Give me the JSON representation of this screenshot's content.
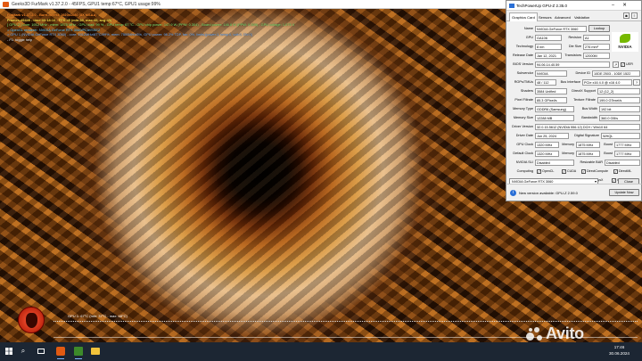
{
  "furmark": {
    "window_title": "Geeks3D FurMark v1.37.2.0 - 45FPS, GPU1 temp:67°C, GPU1 usage:99%",
    "osd": {
      "title": "FurMark v1.37.2.0 - Burn-in test, 1920x1080 (8X MSAA)",
      "frames": "Frames:49445 - time:00:18:13 - FPS:45 (min:39, max:49, avg:45)",
      "gpu2": "[ GPU-Z ] core: 1912 MHz - mem: 1875 MHz - GPU load: 99 % - GPU temp: 67 °C - GPU chip power: 147.9 W (PPW: 0.304) - Board power: 146.8 W (PPW: 0.309) - GPU voltage: 1.075 V",
      "opengl": "> OpenGL renderer: NVIDIA GeForce RTX 3060/PCIe/SSE2",
      "gpu1": "> GPU 1 (NVIDIA GeForce RTX 3060) - core: 1912MHz/67°C/99%, mem: 7500MHz/6%, GPU power: 98.2% TDP, fan: 0%, limits:[power:1, temp:0, volt:0, OV:0]",
      "help": "- F1: toggle help"
    },
    "graph_label": "GPU 1: 67°C (min: 37°C - max: 68°C)"
  },
  "gpuz": {
    "title": "TechPowerUp GPU-Z 2.35.0",
    "tabs": [
      "Graphics Card",
      "Sensors",
      "Advanced",
      "Validation"
    ],
    "lookup_label": "Lookup",
    "vendor_logo_text": "NVIDIA",
    "rows": {
      "name": {
        "label": "Name",
        "value": "NVIDIA GeForce RTX 3060"
      },
      "gpu": {
        "label": "GPU",
        "value": "GA106",
        "label2": "Revision",
        "value2": "A1"
      },
      "tech": {
        "label": "Technology",
        "value": "8 nm",
        "label2": "Die Size",
        "value2": "276 mm²"
      },
      "release": {
        "label": "Release Date",
        "value": "Jan 12, 2021",
        "label2": "Transistors",
        "value2": "12000M"
      },
      "bios": {
        "label": "BIOS Version",
        "value": "94.06.14.40.59",
        "uefi": "UEFI"
      },
      "subvendor": {
        "label": "Subvendor",
        "value": "NVIDIA",
        "label2": "Device ID",
        "value2": "10DE 2503 - 10DE 1522"
      },
      "rops": {
        "label": "ROPs/TMUs",
        "value": "48 / 112",
        "label2": "Bus Interface",
        "value2": "PCIe x16 4.0 @ x16 4.0"
      },
      "shaders": {
        "label": "Shaders",
        "value": "3584 Unified",
        "label2": "DirectX Support",
        "value2": "12 (12_2)"
      },
      "pixel": {
        "label": "Pixel Fillrate",
        "value": "85.3 GPixel/s",
        "label2": "Texture Fillrate",
        "value2": "199.0 GTexel/s"
      },
      "memtype": {
        "label": "Memory Type",
        "value": "GDDR6 (Samsung)",
        "label2": "Bus Width",
        "value2": "192 bit"
      },
      "memsize": {
        "label": "Memory Size",
        "value": "12288 MB",
        "label2": "Bandwidth",
        "value2": "360.0 GB/s"
      },
      "driver": {
        "label": "Driver Version",
        "value": "32.0.15.5612 (NVIDIA 556.12) DCH / Win10 64"
      },
      "driverdate": {
        "label": "Driver Date",
        "value": "Jun 25, 2024",
        "label2": "Digital Signature",
        "value2": "WHQL"
      },
      "gpuclock": {
        "label": "GPU Clock",
        "value": "1320 MHz",
        "label2": "Memory",
        "value2": "1875 MHz",
        "label3": "Boost",
        "value3": "1777 MHz"
      },
      "defclock": {
        "label": "Default Clock",
        "value": "1320 MHz",
        "label2": "Memory",
        "value2": "1875 MHz",
        "label3": "Boost",
        "value3": "1777 MHz"
      },
      "sli": {
        "label": "NVIDIA SLI",
        "value": "Disabled",
        "label2": "Resizable BAR",
        "value2": "Disabled"
      },
      "computing": {
        "label": "Computing",
        "items": [
          "OpenCL",
          "CUDA",
          "DirectCompute",
          "DirectML"
        ]
      },
      "technologies": {
        "label": "Technologies",
        "items": [
          "Vulkan",
          "Ray Tracing",
          "PhysX",
          "OpenGL 4.6"
        ]
      }
    },
    "selected_gpu": "NVIDIA GeForce RTX 3060",
    "close_label": "Close",
    "update": {
      "message": "New version available: GPU-Z 2.59.0",
      "button": "Update Now"
    }
  },
  "taskbar": {
    "time": "17:46",
    "date": "30.06.2024"
  },
  "watermark": {
    "text": "Avito"
  }
}
